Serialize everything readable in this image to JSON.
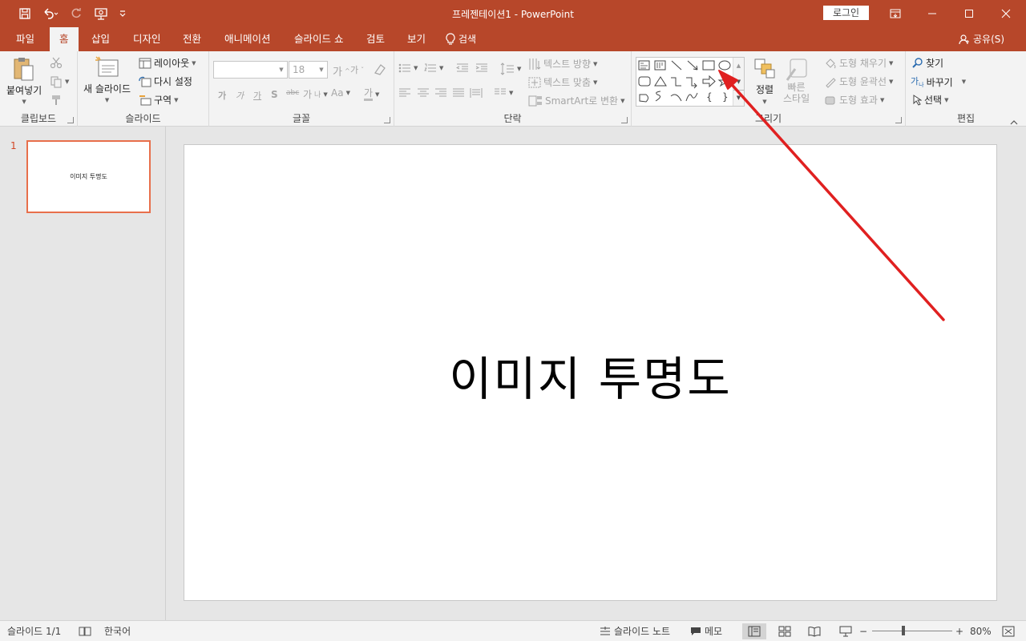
{
  "window": {
    "title": "프레젠테이션1  -  PowerPoint",
    "login_label": "로그인"
  },
  "tabs": [
    {
      "label": "파일"
    },
    {
      "label": "홈"
    },
    {
      "label": "삽입"
    },
    {
      "label": "디자인"
    },
    {
      "label": "전환"
    },
    {
      "label": "애니메이션"
    },
    {
      "label": "슬라이드 쇼"
    },
    {
      "label": "검토"
    },
    {
      "label": "보기"
    }
  ],
  "tell_me": "검색",
  "share": "공유(S)",
  "ribbon": {
    "clipboard": {
      "paste": "붙여넣기",
      "label": "클립보드"
    },
    "slides": {
      "new_slide": "새 슬라이드",
      "layout": "레이아웃",
      "reset": "다시 설정",
      "section": "구역",
      "label": "슬라이드"
    },
    "font": {
      "size": "18",
      "label": "글꼴"
    },
    "paragraph": {
      "text_direction": "텍스트 방향",
      "align_text": "텍스트 맞춤",
      "smartart": "SmartArt로 변환",
      "label": "단락"
    },
    "drawing": {
      "arrange": "정렬",
      "quick_styles": "빠른\n스타일",
      "quick_styles_l1": "빠른",
      "quick_styles_l2": "스타일",
      "shape_fill": "도형 채우기",
      "shape_outline": "도형 윤곽선",
      "shape_effects": "도형 효과",
      "label": "그리기"
    },
    "editing": {
      "find": "찾기",
      "replace": "바꾸기",
      "select": "선택",
      "label": "편집"
    }
  },
  "thumbnails": [
    {
      "number": "1",
      "text": "이미지 투명도"
    }
  ],
  "slide": {
    "title": "이미지 투명도"
  },
  "status": {
    "slide_count": "슬라이드 1/1",
    "language": "한국어",
    "notes": "슬라이드 노트",
    "comments": "메모",
    "zoom": "80%",
    "zoom_level": 0.8
  },
  "colors": {
    "accent": "#b7472a",
    "annotation_arrow": "#e02020"
  }
}
